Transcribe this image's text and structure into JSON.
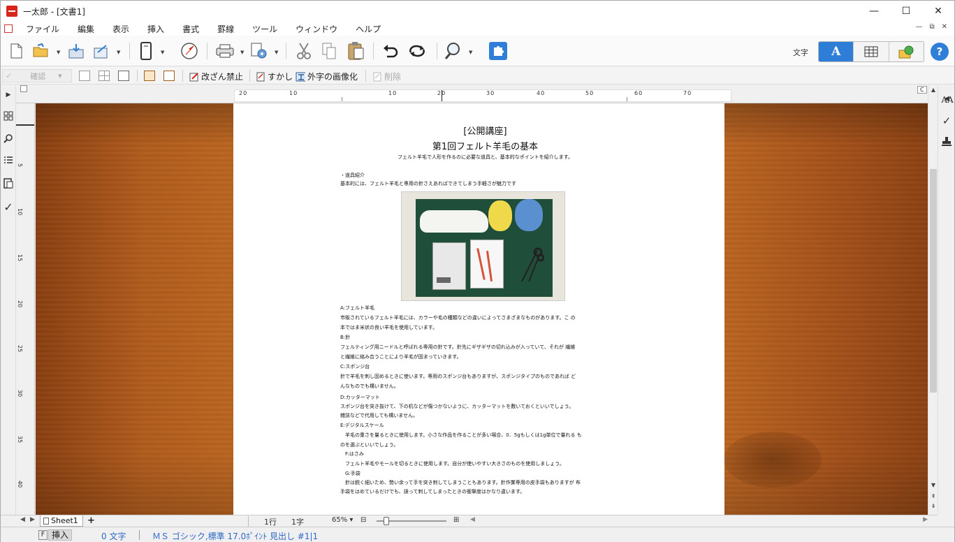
{
  "window": {
    "title": "一太郎 - [文書1]",
    "controls": [
      "—",
      "☐",
      "✕"
    ]
  },
  "menu": {
    "items": [
      "ファイル",
      "編集",
      "表示",
      "挿入",
      "書式",
      "罫線",
      "ツール",
      "ウィンドウ",
      "ヘルプ"
    ],
    "right_controls": [
      "—",
      "⧉",
      "✕"
    ]
  },
  "toolbar": {
    "mode_label": "文字",
    "mode_text_button": "A",
    "help": "?"
  },
  "toolbar2": {
    "confirm": "確認",
    "kaizan": "改ざん禁止",
    "sukashi": "すかし",
    "gaiji": "外字の画像化",
    "delete": "削除"
  },
  "ruler": {
    "h_numbers": [
      "20",
      "10",
      "10",
      "20",
      "30",
      "40",
      "50",
      "60",
      "70"
    ],
    "v_numbers": [
      "5",
      "10",
      "15",
      "20",
      "25",
      "30",
      "35",
      "40"
    ],
    "h_right_mark": "C"
  },
  "document": {
    "title1": "[公開講座]",
    "title2": "第1回フェルト羊毛の基本",
    "subtitle": "フェルト羊毛で人形を作るのに必要な道具と、基本的なポイントを紹介します。",
    "lines": [
      "・道具紹介",
      "基本的には、フェルト羊毛と専用の針さえあればできてしまう手軽さが魅力です",
      "A:フェルト羊毛",
      "市販されているフェルト羊毛には、カラーや毛の種類などの違いによってさまざまなものがあります。こ の",
      "本ではま米状の良い羊毛を使用しています。",
      "B:針",
      "フェルティング用ニードルと呼ばれる専用の針です。針先にギザギザの切れ込みが入っていて、それが 繊維",
      "と繊維に絡み合うことにより羊毛が固まっていきます。",
      "C:スポンジ台",
      "針で羊毛を刺し固めるときに使います。専用のスポンジ台もありますが、スポンジタイプのものであれば ど",
      "んなものでも構いません。",
      "D:カッターマット",
      "スポンジ台を突き抜けて、下の机などが傷つかないように、カッターマットを敷いておくといいでしょう。",
      "雑誌などで代用しても構いません。",
      "E:デジタルスケール",
      "　羊毛の重さを量るときに使用します。小さな作品を作ることが多い場合、0．5gもしくは1g単位で量れる も",
      "のを選ぶといいでしょう。",
      "　F:はさみ",
      "　フェルト羊毛やモールを切るときに使用します。自分が使いやすい大きさのものを使用しましょう。",
      "　G:手袋",
      "　針は鋭く細いため、勢い余って手を突き刺してしまうこともあります。針作業専用の皮手袋もありますが 布",
      "手袋をはめているだけでも、誤って刺してしまったときの衝撃度はかなり違います。"
    ]
  },
  "sheetbar": {
    "sheet_name": "Sheet1",
    "add": "+",
    "line": "1行",
    "char": "1字",
    "zoom": "65%"
  },
  "statusbar": {
    "f_key": "F",
    "mode": "挿入",
    "char_count": "0 文字",
    "font_info": "ＭＳ ゴシック,標準  17.0ﾎﾟｲﾝﾄ  見出し #1|1"
  },
  "colors": {
    "accent": "#2e7dd7",
    "app_icon": "#d9261c",
    "status_text": "#2f68c8"
  }
}
